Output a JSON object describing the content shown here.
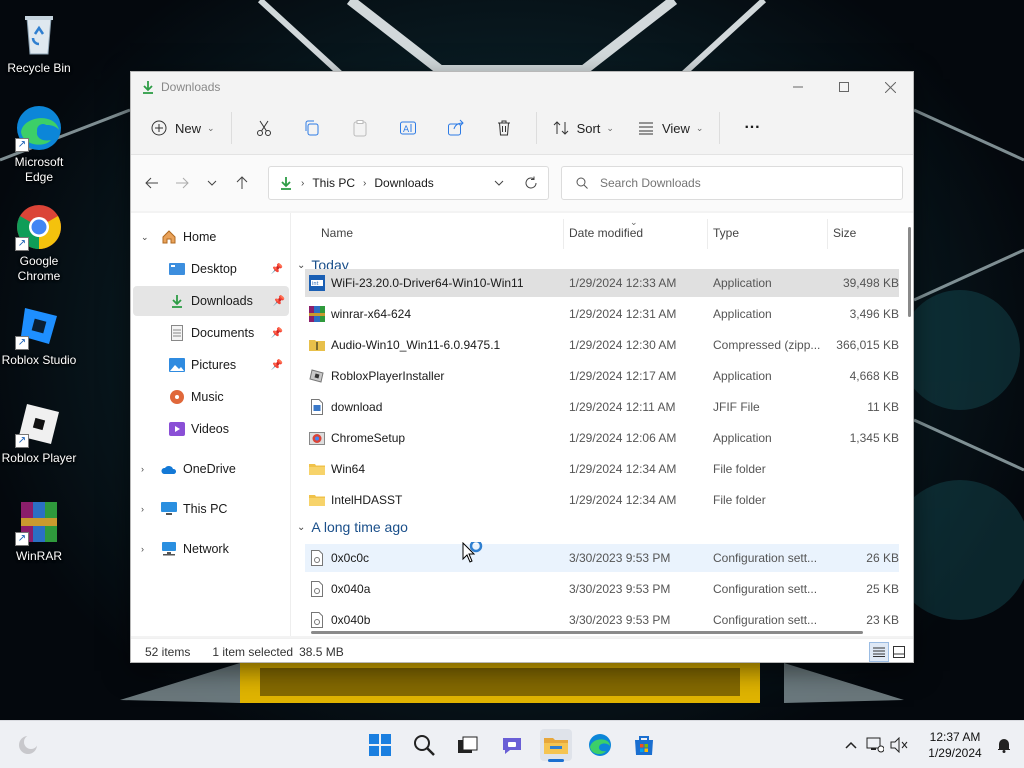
{
  "desktop": {
    "icons": [
      {
        "label": "Recycle Bin"
      },
      {
        "label": "Microsoft Edge"
      },
      {
        "label": "Google Chrome"
      },
      {
        "label": "Roblox Studio"
      },
      {
        "label": "Roblox Player"
      },
      {
        "label": "WinRAR"
      }
    ]
  },
  "window": {
    "title": "Downloads",
    "toolbar": {
      "new_label": "New",
      "sort_label": "Sort",
      "view_label": "View",
      "more_label": "···"
    },
    "address": {
      "crumbs": [
        "This PC",
        "Downloads"
      ]
    },
    "search": {
      "placeholder": "Search Downloads"
    },
    "nav": {
      "home": "Home",
      "desktop": "Desktop",
      "downloads": "Downloads",
      "documents": "Documents",
      "pictures": "Pictures",
      "music": "Music",
      "videos": "Videos",
      "onedrive": "OneDrive",
      "thispc": "This PC",
      "network": "Network"
    },
    "columns": {
      "name": "Name",
      "date": "Date modified",
      "type": "Type",
      "size": "Size"
    },
    "groups": {
      "today": "Today",
      "older": "A long time ago"
    },
    "files": [
      {
        "name": "WiFi-23.20.0-Driver64-Win10-Win11",
        "date": "1/29/2024 12:33 AM",
        "type": "Application",
        "size": "39,498 KB",
        "icon": "wifi-installer"
      },
      {
        "name": "winrar-x64-624",
        "date": "1/29/2024 12:31 AM",
        "type": "Application",
        "size": "3,496 KB",
        "icon": "winrar-installer"
      },
      {
        "name": "Audio-Win10_Win11-6.0.9475.1",
        "date": "1/29/2024 12:30 AM",
        "type": "Compressed (zipp...",
        "size": "366,015 KB",
        "icon": "zip-folder"
      },
      {
        "name": "RobloxPlayerInstaller",
        "date": "1/29/2024 12:17 AM",
        "type": "Application",
        "size": "4,668 KB",
        "icon": "roblox-installer"
      },
      {
        "name": "download",
        "date": "1/29/2024 12:11 AM",
        "type": "JFIF File",
        "size": "11 KB",
        "icon": "image-file"
      },
      {
        "name": "ChromeSetup",
        "date": "1/29/2024 12:06 AM",
        "type": "Application",
        "size": "1,345 KB",
        "icon": "chrome-installer"
      },
      {
        "name": "Win64",
        "date": "1/29/2024 12:34 AM",
        "type": "File folder",
        "size": "",
        "icon": "folder"
      },
      {
        "name": "IntelHDASST",
        "date": "1/29/2024 12:34 AM",
        "type": "File folder",
        "size": "",
        "icon": "folder"
      }
    ],
    "older_files": [
      {
        "name": "0x0c0c",
        "date": "3/30/2023 9:53 PM",
        "type": "Configuration sett...",
        "size": "26 KB",
        "icon": "config-file"
      },
      {
        "name": "0x040a",
        "date": "3/30/2023 9:53 PM",
        "type": "Configuration sett...",
        "size": "25 KB",
        "icon": "config-file"
      },
      {
        "name": "0x040b",
        "date": "3/30/2023 9:53 PM",
        "type": "Configuration sett...",
        "size": "23 KB",
        "icon": "config-file"
      }
    ],
    "status": {
      "count": "52 items",
      "selected": "1 item selected",
      "size": "38.5 MB"
    }
  },
  "taskbar": {
    "time": "12:37 AM",
    "date": "1/29/2024"
  },
  "colors": {
    "accent": "#0067c0",
    "selection": "#e0e0e0",
    "hover": "#eaf3fd",
    "download_green": "#2e9d46"
  }
}
